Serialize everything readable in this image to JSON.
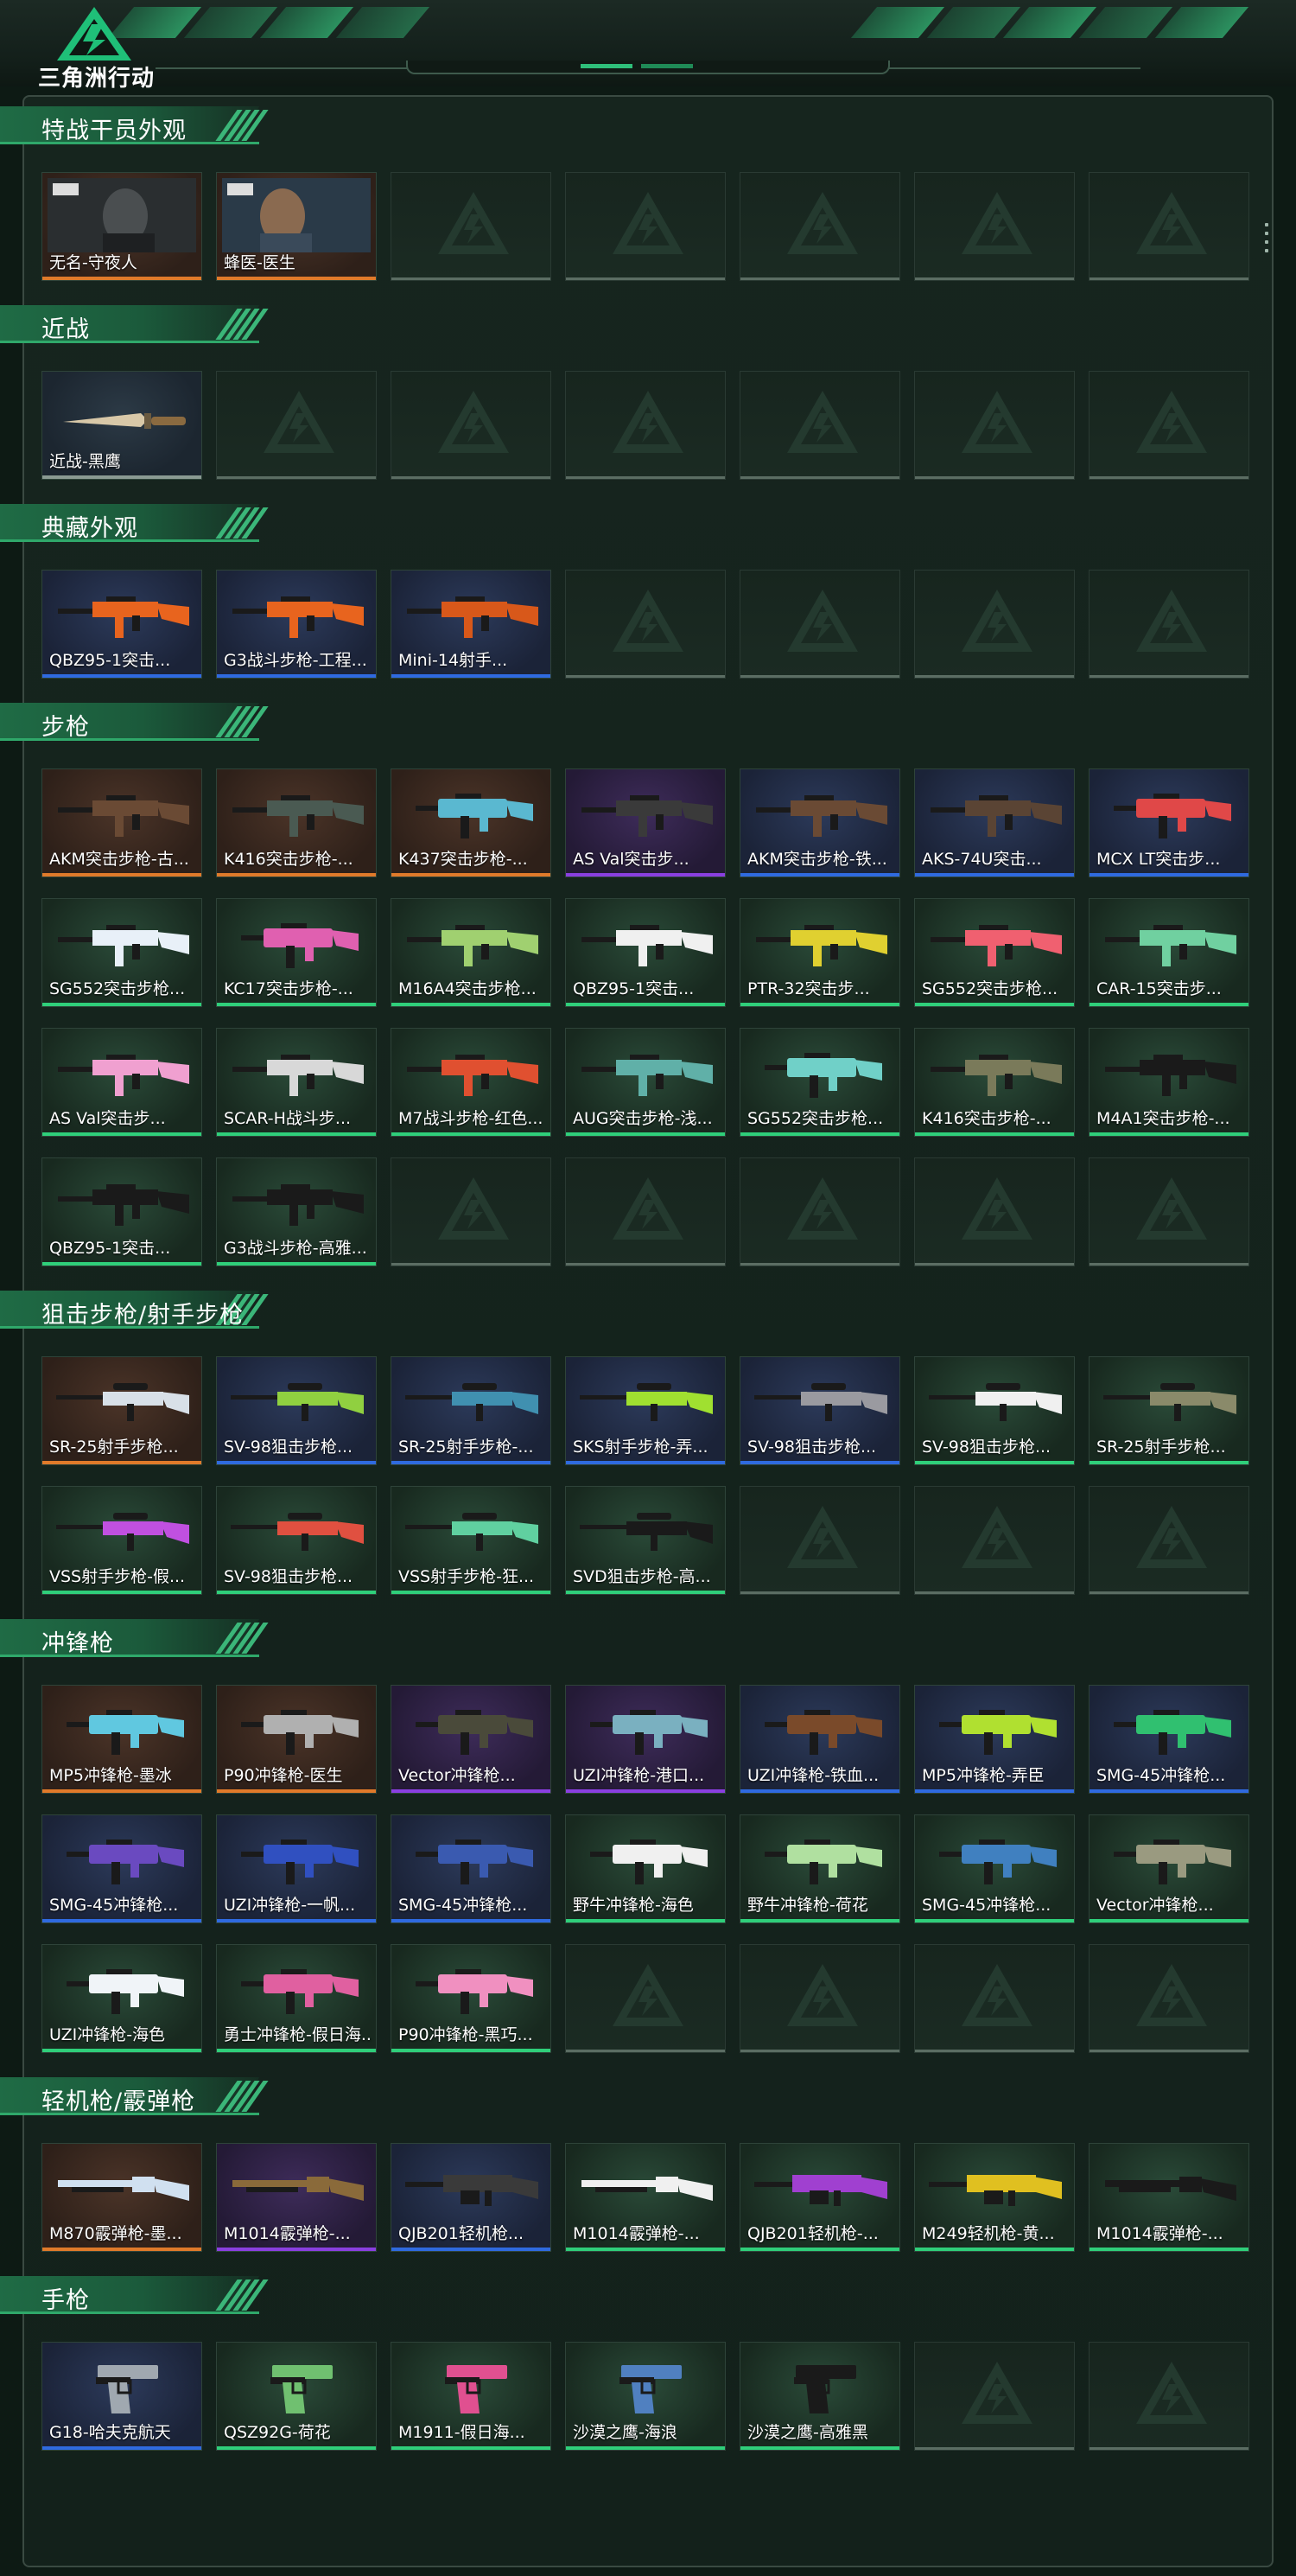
{
  "header": {
    "logo_text": "三角洲行动"
  },
  "colors": {
    "accent": "#2fbf7a",
    "rarity_orange": "#e07a2a",
    "rarity_purple": "#8a3fe0",
    "rarity_blue": "#2f6ae0",
    "rarity_green": "#2fcf7a"
  },
  "sections": [
    {
      "title": "特战干员外观",
      "items": [
        {
          "name": "无名-守夜人",
          "rarity": "orange",
          "kind": "operator",
          "badge": "守夜人"
        },
        {
          "name": "蜂医-医生",
          "rarity": "orange",
          "kind": "operator",
          "badge": "医生"
        }
      ],
      "rows": 1
    },
    {
      "title": "近战",
      "items": [
        {
          "name": "近战-黑鹰",
          "rarity": "none",
          "kind": "knife"
        }
      ],
      "rows": 1
    },
    {
      "title": "典藏外观",
      "items": [
        {
          "name": "QBZ95-1突击...",
          "rarity": "blue",
          "kind": "rifle",
          "color": "#e8641e"
        },
        {
          "name": "G3战斗步枪-工程...",
          "rarity": "blue",
          "kind": "rifle",
          "color": "#e8641e"
        },
        {
          "name": "Mini-14射手...",
          "rarity": "blue",
          "kind": "rifle",
          "color": "#d8581a"
        }
      ],
      "rows": 1
    },
    {
      "title": "步枪",
      "items": [
        {
          "name": "AKM突击步枪-古...",
          "rarity": "orange",
          "kind": "rifle",
          "color": "#6a4a34"
        },
        {
          "name": "K416突击步枪-...",
          "rarity": "orange",
          "kind": "rifle",
          "color": "#4a5a52"
        },
        {
          "name": "K437突击步枪-...",
          "rarity": "orange",
          "kind": "smg",
          "color": "#5ab8d0"
        },
        {
          "name": "AS Val突击步...",
          "rarity": "purple",
          "kind": "rifle",
          "color": "#3a3a3a"
        },
        {
          "name": "AKM突击步枪-铁...",
          "rarity": "blue",
          "kind": "rifle",
          "color": "#6a4a34"
        },
        {
          "name": "AKS-74U突击...",
          "rarity": "blue",
          "kind": "rifle",
          "color": "#5a4434"
        },
        {
          "name": "MCX LT突击步...",
          "rarity": "blue",
          "kind": "smg",
          "color": "#e04848"
        },
        {
          "name": "SG552突击步枪...",
          "rarity": "green",
          "kind": "rifle",
          "color": "#e8f0f8"
        },
        {
          "name": "KC17突击步枪-...",
          "rarity": "green",
          "kind": "smg",
          "color": "#e060b0"
        },
        {
          "name": "M16A4突击步枪...",
          "rarity": "green",
          "kind": "rifle",
          "color": "#a0d070"
        },
        {
          "name": "QBZ95-1突击...",
          "rarity": "green",
          "kind": "rifle",
          "color": "#f0f0f0"
        },
        {
          "name": "PTR-32突击步...",
          "rarity": "green",
          "kind": "rifle",
          "color": "#e0d030"
        },
        {
          "name": "SG552突击步枪...",
          "rarity": "green",
          "kind": "rifle",
          "color": "#f06070"
        },
        {
          "name": "CAR-15突击步...",
          "rarity": "green",
          "kind": "rifle",
          "color": "#70d0a0"
        },
        {
          "name": "AS Val突击步...",
          "rarity": "green",
          "kind": "rifle",
          "color": "#f0a0d0"
        },
        {
          "name": "SCAR-H战斗步...",
          "rarity": "green",
          "kind": "rifle",
          "color": "#d8d8d8"
        },
        {
          "name": "M7战斗步枪-红色...",
          "rarity": "green",
          "kind": "rifle",
          "color": "#e05030"
        },
        {
          "name": "AUG突击步枪-浅...",
          "rarity": "green",
          "kind": "rifle",
          "color": "#60b0a8"
        },
        {
          "name": "SG552突击步枪...",
          "rarity": "green",
          "kind": "smg",
          "color": "#70d0c8"
        },
        {
          "name": "K416突击步枪-...",
          "rarity": "green",
          "kind": "rifle",
          "color": "#7a7a5a"
        },
        {
          "name": "M4A1突击步枪-...",
          "rarity": "green",
          "kind": "rifle",
          "color": "#1a1a1a"
        },
        {
          "name": "QBZ95-1突击...",
          "rarity": "green",
          "kind": "rifle",
          "color": "#1a1a1a"
        },
        {
          "name": "G3战斗步枪-高雅...",
          "rarity": "green",
          "kind": "rifle",
          "color": "#1a1a1a"
        }
      ],
      "rows": 4
    },
    {
      "title": "狙击步枪/射手步枪",
      "items": [
        {
          "name": "SR-25射手步枪...",
          "rarity": "orange",
          "kind": "sniper",
          "color": "#d8e0e8"
        },
        {
          "name": "SV-98狙击步枪...",
          "rarity": "blue",
          "kind": "sniper",
          "color": "#90d040"
        },
        {
          "name": "SR-25射手步枪-...",
          "rarity": "blue",
          "kind": "sniper",
          "color": "#4090b0"
        },
        {
          "name": "SKS射手步枪-弄...",
          "rarity": "blue",
          "kind": "sniper",
          "color": "#a0e030"
        },
        {
          "name": "SV-98狙击步枪...",
          "rarity": "blue",
          "kind": "sniper",
          "color": "#9a9aa0"
        },
        {
          "name": "SV-98狙击步枪...",
          "rarity": "green",
          "kind": "sniper",
          "color": "#f0f0f0"
        },
        {
          "name": "SR-25射手步枪...",
          "rarity": "green",
          "kind": "sniper",
          "color": "#8a8a6a"
        },
        {
          "name": "VSS射手步枪-假...",
          "rarity": "green",
          "kind": "sniper",
          "color": "#c050e0"
        },
        {
          "name": "SV-98狙击步枪...",
          "rarity": "green",
          "kind": "sniper",
          "color": "#e05040"
        },
        {
          "name": "VSS射手步枪-狂...",
          "rarity": "green",
          "kind": "sniper",
          "color": "#60d0a0"
        },
        {
          "name": "SVD狙击步枪-高...",
          "rarity": "green",
          "kind": "sniper",
          "color": "#1a1a1a"
        }
      ],
      "rows": 2
    },
    {
      "title": "冲锋枪",
      "items": [
        {
          "name": "MP5冲锋枪-墨冰",
          "rarity": "orange",
          "kind": "smg",
          "color": "#60c8e0"
        },
        {
          "name": "P90冲锋枪-医生",
          "rarity": "orange",
          "kind": "smg",
          "color": "#b0b0b0"
        },
        {
          "name": "Vector冲锋枪...",
          "rarity": "purple",
          "kind": "smg",
          "color": "#4a4a3a"
        },
        {
          "name": "UZI冲锋枪-港口...",
          "rarity": "purple",
          "kind": "smg",
          "color": "#7ab0c0"
        },
        {
          "name": "UZI冲锋枪-铁血...",
          "rarity": "blue",
          "kind": "smg",
          "color": "#7a4a2a"
        },
        {
          "name": "MP5冲锋枪-弄臣",
          "rarity": "blue",
          "kind": "smg",
          "color": "#b0e030"
        },
        {
          "name": "SMG-45冲锋枪...",
          "rarity": "blue",
          "kind": "smg",
          "color": "#30c070"
        },
        {
          "name": "SMG-45冲锋枪...",
          "rarity": "blue",
          "kind": "smg",
          "color": "#6a4ac0"
        },
        {
          "name": "UZI冲锋枪-一帆...",
          "rarity": "blue",
          "kind": "smg",
          "color": "#3050c0"
        },
        {
          "name": "SMG-45冲锋枪...",
          "rarity": "blue",
          "kind": "smg",
          "color": "#3a5ab0"
        },
        {
          "name": "野牛冲锋枪-海色",
          "rarity": "green",
          "kind": "smg",
          "color": "#f0f0f0"
        },
        {
          "name": "野牛冲锋枪-荷花",
          "rarity": "green",
          "kind": "smg",
          "color": "#b0e0a0"
        },
        {
          "name": "SMG-45冲锋枪...",
          "rarity": "green",
          "kind": "smg",
          "color": "#4080c0"
        },
        {
          "name": "Vector冲锋枪...",
          "rarity": "green",
          "kind": "smg",
          "color": "#9a9a80"
        },
        {
          "name": "UZI冲锋枪-海色",
          "rarity": "green",
          "kind": "smg",
          "color": "#f0f4f8"
        },
        {
          "name": "勇士冲锋枪-假日海...",
          "rarity": "green",
          "kind": "smg",
          "color": "#e060a0"
        },
        {
          "name": "P90冲锋枪-黑巧...",
          "rarity": "green",
          "kind": "smg",
          "color": "#f090c0"
        }
      ],
      "rows": 3
    },
    {
      "title": "轻机枪/霰弹枪",
      "items": [
        {
          "name": "M870霰弹枪-墨...",
          "rarity": "orange",
          "kind": "shotgun",
          "color": "#d0e0f0"
        },
        {
          "name": "M1014霰弹枪-...",
          "rarity": "purple",
          "kind": "shotgun",
          "color": "#8a6a3a"
        },
        {
          "name": "QJB201轻机枪...",
          "rarity": "blue",
          "kind": "lmg",
          "color": "#3a3a3a"
        },
        {
          "name": "M1014霰弹枪-...",
          "rarity": "green",
          "kind": "shotgun",
          "color": "#f0f0f0"
        },
        {
          "name": "QJB201轻机枪-...",
          "rarity": "green",
          "kind": "lmg",
          "color": "#a040d0"
        },
        {
          "name": "M249轻机枪-黄...",
          "rarity": "green",
          "kind": "lmg",
          "color": "#e0c020"
        },
        {
          "name": "M1014霰弹枪-...",
          "rarity": "green",
          "kind": "shotgun",
          "color": "#1a1a1a"
        }
      ],
      "rows": 1
    },
    {
      "title": "手枪",
      "items": [
        {
          "name": "G18-哈夫克航天",
          "rarity": "blue",
          "kind": "pistol",
          "color": "#a0a8b0"
        },
        {
          "name": "QSZ92G-荷花",
          "rarity": "green",
          "kind": "pistol",
          "color": "#70c070"
        },
        {
          "name": "M1911-假日海...",
          "rarity": "green",
          "kind": "pistol",
          "color": "#e05090"
        },
        {
          "name": "沙漠之鹰-海浪",
          "rarity": "green",
          "kind": "pistol",
          "color": "#5080c0"
        },
        {
          "name": "沙漠之鹰-高雅黑",
          "rarity": "green",
          "kind": "pistol",
          "color": "#1a1a1a"
        }
      ],
      "rows": 1
    }
  ]
}
